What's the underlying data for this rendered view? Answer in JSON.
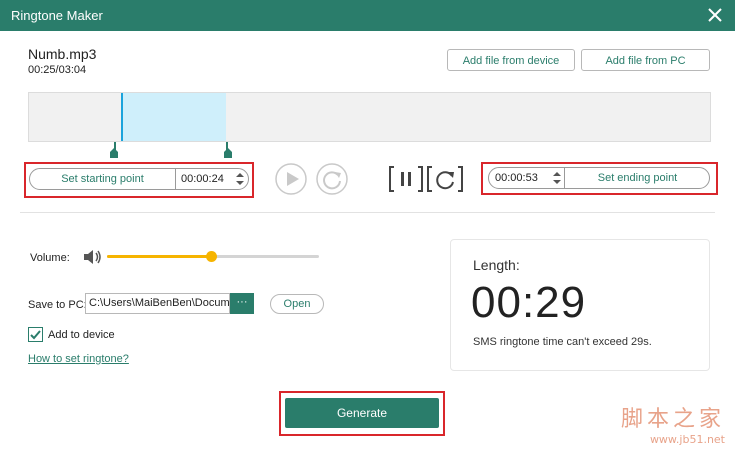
{
  "window": {
    "title": "Ringtone Maker"
  },
  "file": {
    "name": "Numb.mp3",
    "time": "00:25/03:04"
  },
  "buttons": {
    "add_from_device": "Add file from device",
    "add_from_pc": "Add file from PC",
    "generate": "Generate",
    "open": "Open",
    "browse": "···"
  },
  "start": {
    "label": "Set starting point",
    "value": "00:00:24"
  },
  "end": {
    "label": "Set ending point",
    "value": "00:00:53"
  },
  "volume": {
    "label": "Volume:",
    "level": 0.49
  },
  "save": {
    "label": "Save to PC:",
    "path": "C:\\Users\\MaiBenBen\\Docume"
  },
  "add_device": {
    "label": "Add to device",
    "checked": true
  },
  "help_link": "How to set ringtone?",
  "length": {
    "label": "Length:",
    "value": "00:29",
    "note": "SMS ringtone time can't exceed 29s."
  },
  "colors": {
    "accent": "#2a7d6b",
    "highlight": "#d9262b",
    "slider": "#f6b400",
    "selection": "#cfeffb"
  },
  "watermark": {
    "brand": "脚本之家",
    "url": "www.jb51.net"
  }
}
